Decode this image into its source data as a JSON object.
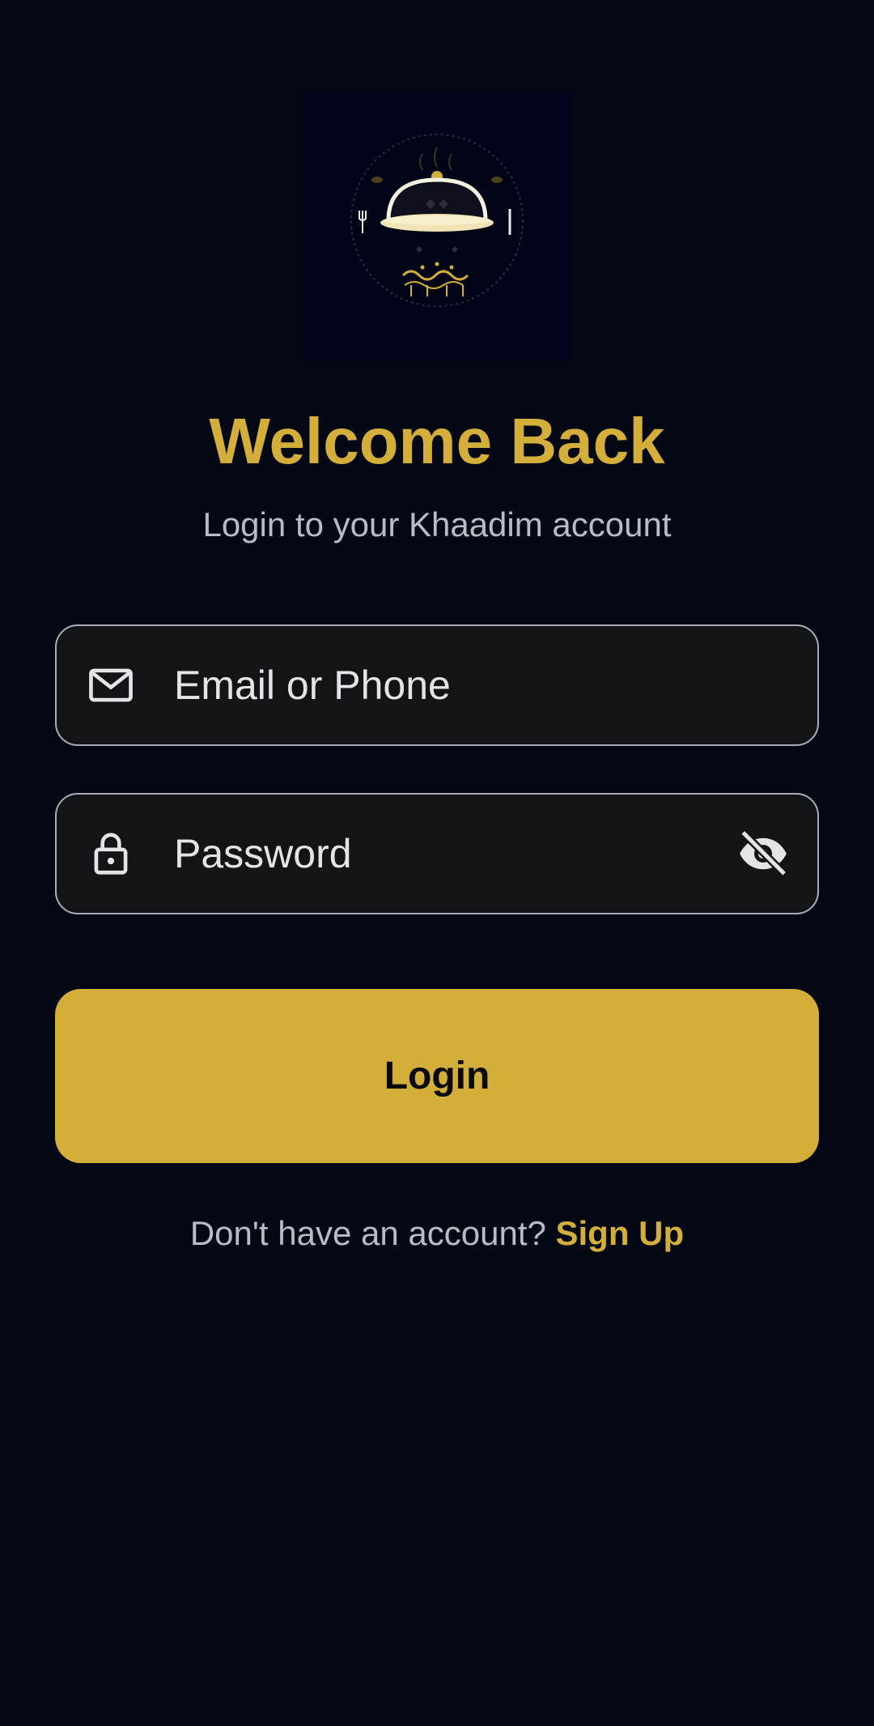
{
  "colors": {
    "background": "#030814",
    "accent": "#d4ae3a",
    "field_background": "#131418",
    "field_border": "#a9acb4",
    "muted_text": "#b9bcc4"
  },
  "logo": {
    "icon": "serving-cloche-logo"
  },
  "header": {
    "title": "Welcome Back",
    "subtitle": "Login to your Khaadim account"
  },
  "form": {
    "email": {
      "icon": "mail-icon",
      "placeholder": "Email or Phone",
      "value": ""
    },
    "password": {
      "icon": "lock-icon",
      "placeholder": "Password",
      "value": "",
      "toggle_icon": "eye-off-icon"
    },
    "login_label": "Login"
  },
  "footer": {
    "prompt": "Don't have an account?",
    "link_label": "Sign Up"
  }
}
